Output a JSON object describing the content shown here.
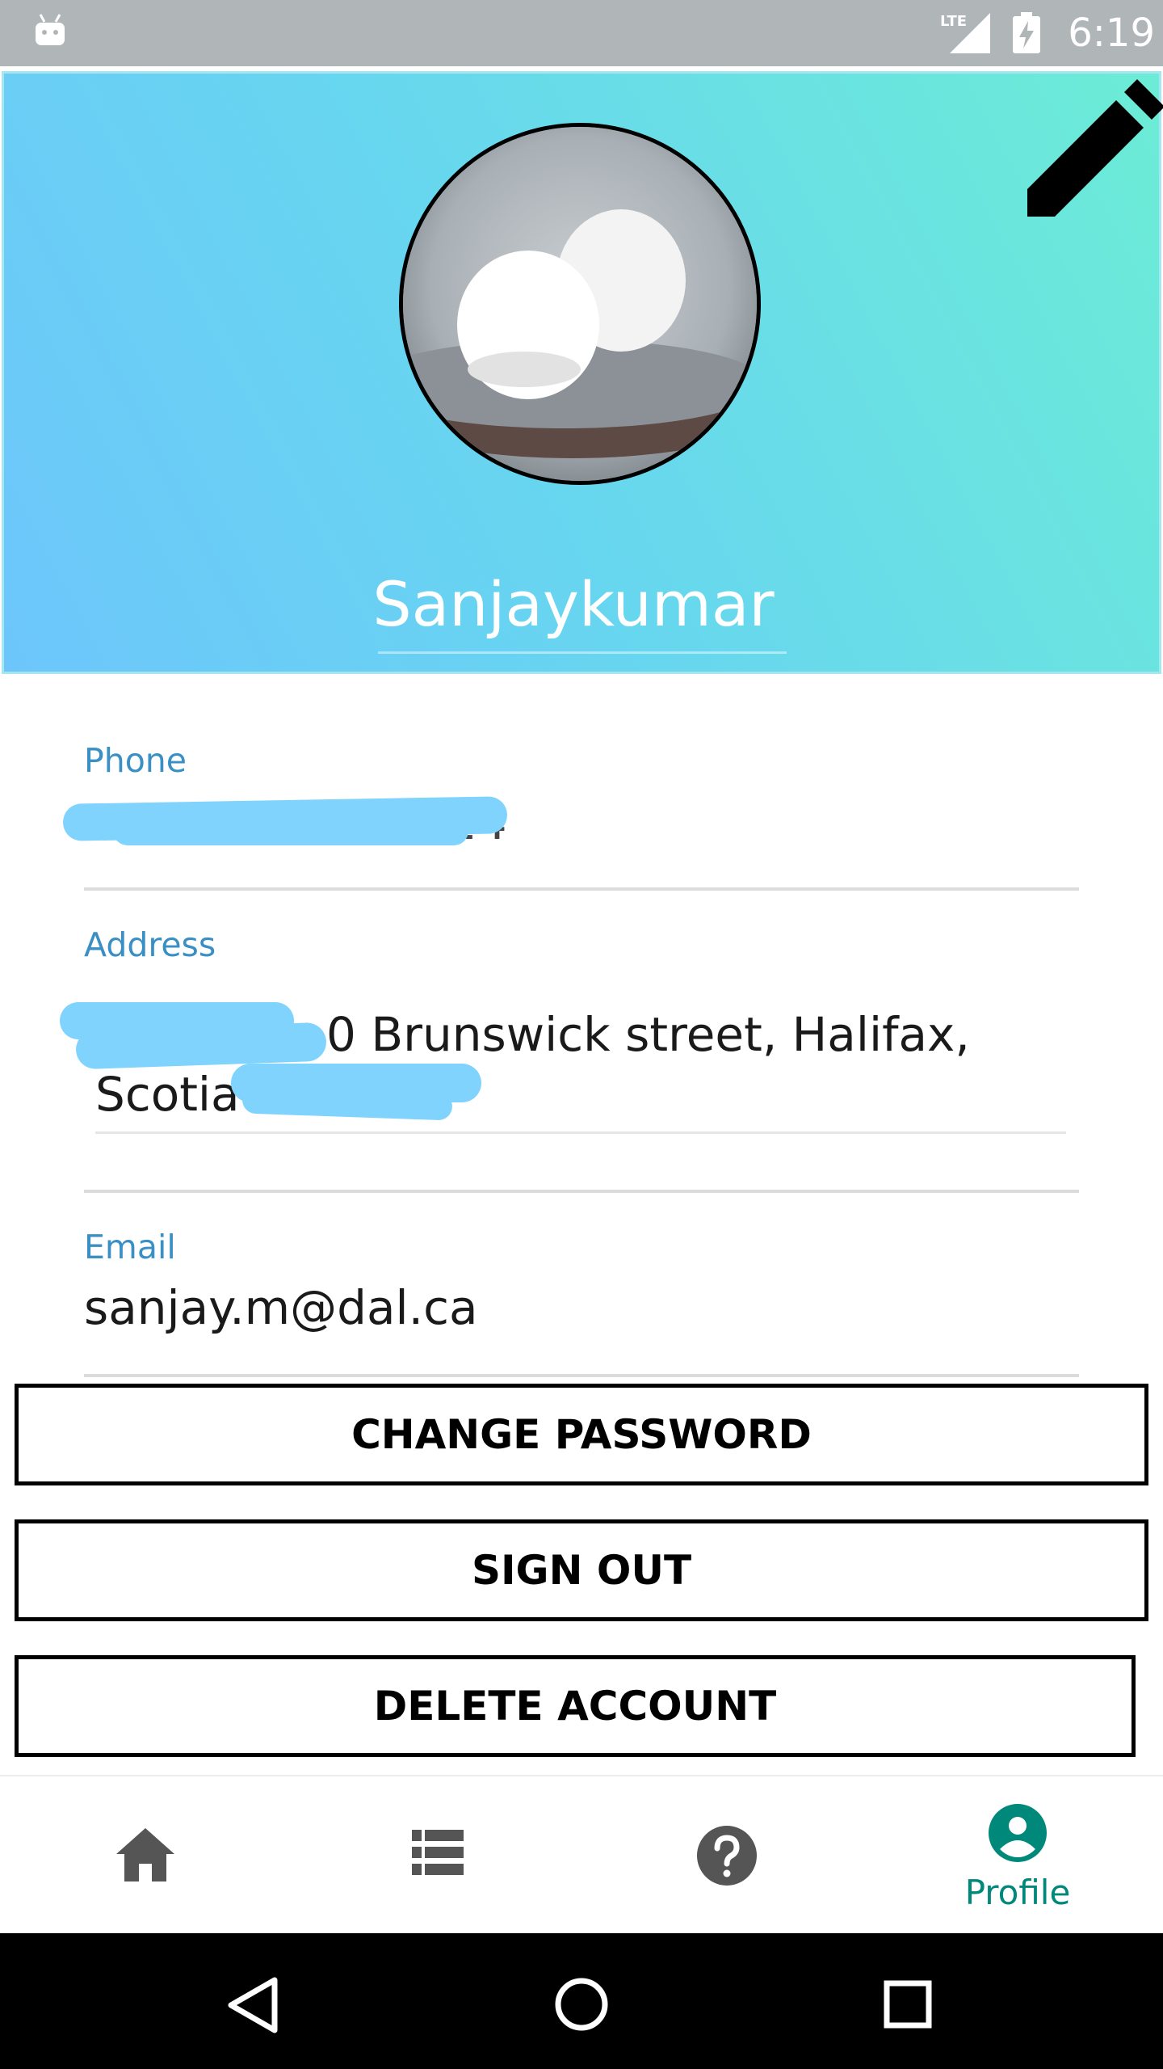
{
  "status_bar": {
    "time": "6:19",
    "network": "LTE",
    "icons": [
      "android-icon",
      "lte-signal-icon",
      "battery-charging-icon"
    ]
  },
  "header": {
    "username": "Sanjaykumar",
    "edit_icon": "pencil-icon",
    "avatar_alt": "profile-photo"
  },
  "fields": {
    "phone": {
      "label": "Phone",
      "value": "1124"
    },
    "address": {
      "label": "Address",
      "value_line1": "0 Brunswick street, Halifax, Nova",
      "value_line2": "Scotia"
    },
    "email": {
      "label": "Email",
      "value": "sanjay.m@dal.ca"
    }
  },
  "buttons": {
    "change_password": "CHANGE PASSWORD",
    "sign_out": "SIGN OUT",
    "delete_account": "DELETE ACCOUNT"
  },
  "bottom_nav": {
    "items": [
      {
        "icon": "home-icon",
        "label": ""
      },
      {
        "icon": "list-icon",
        "label": ""
      },
      {
        "icon": "help-icon",
        "label": ""
      },
      {
        "icon": "profile-icon",
        "label": "Profile"
      }
    ],
    "active_color": "#00897b",
    "inactive_color": "#555555"
  },
  "colors": {
    "accent": "#3a8fc4",
    "scribble": "#7fd3fc"
  }
}
